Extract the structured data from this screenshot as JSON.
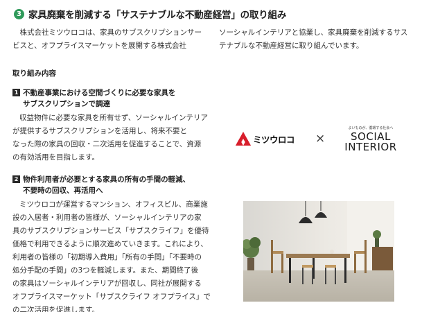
{
  "heading": {
    "number": "3",
    "title": "家具廃棄を削減する「サステナブルな不動産経営」の取り組み"
  },
  "intro": {
    "left": [
      "　株式会社ミツウロコは、家具のサブスクリプションサー",
      "ビスと、オフプライスマーケットを展開する株式会社"
    ],
    "right": [
      "ソーシャルインテリアと協業し、家具廃棄を削減するサス",
      "テナブルな不動産経営に取り組んでいます。"
    ]
  },
  "section_title": "取り組み内容",
  "items": [
    {
      "badge": "1",
      "title_line1": "不動産事業における空間づくりに必要な家具を",
      "title_line2": "サブスクリプションで調達",
      "body": [
        "収益物件に必要な家具を所有せず、ソーシャルインテリア",
        "が提供するサブスクリプションを活用し、将来不要と",
        "なった際の家具の回収・二次活用を促進することで、資源",
        "の有効活用を目指します。"
      ]
    },
    {
      "badge": "2",
      "title_line1": "物件利用者が必要とする家具の所有の手間の軽減、",
      "title_line2": "不要時の回収、再活用へ",
      "body": [
        "ミツウロコが運営するマンション、オフィスビル、商業施",
        "設の入居者・利用者の皆様が、ソーシャルインテリアの家",
        "具のサブスクリプションサービス「サブスクライフ」を優待",
        "価格で利用できるように順次進めていきます。これにより、",
        "利用者の皆様の「初期導入費用」「所有の手間」「不要時の",
        "処分手配の手間」の3つを軽減します。また、期間終了後",
        "の家具はソーシャルインテリアが回収し、同社が展開する",
        "オフプライスマーケット「サブスクライフ オフプライス」で",
        "の二次活用を促進します。"
      ]
    }
  ],
  "logos": {
    "left_name": "ミツウロコ",
    "times": "×",
    "right_tagline": "よいものが、循環する社会へ",
    "right_line1": "SOCIAL",
    "right_line2": "INTERIOR"
  },
  "colors": {
    "accent_green": "#2f9a5a",
    "mitsuuroko_red": "#d81e2b"
  }
}
